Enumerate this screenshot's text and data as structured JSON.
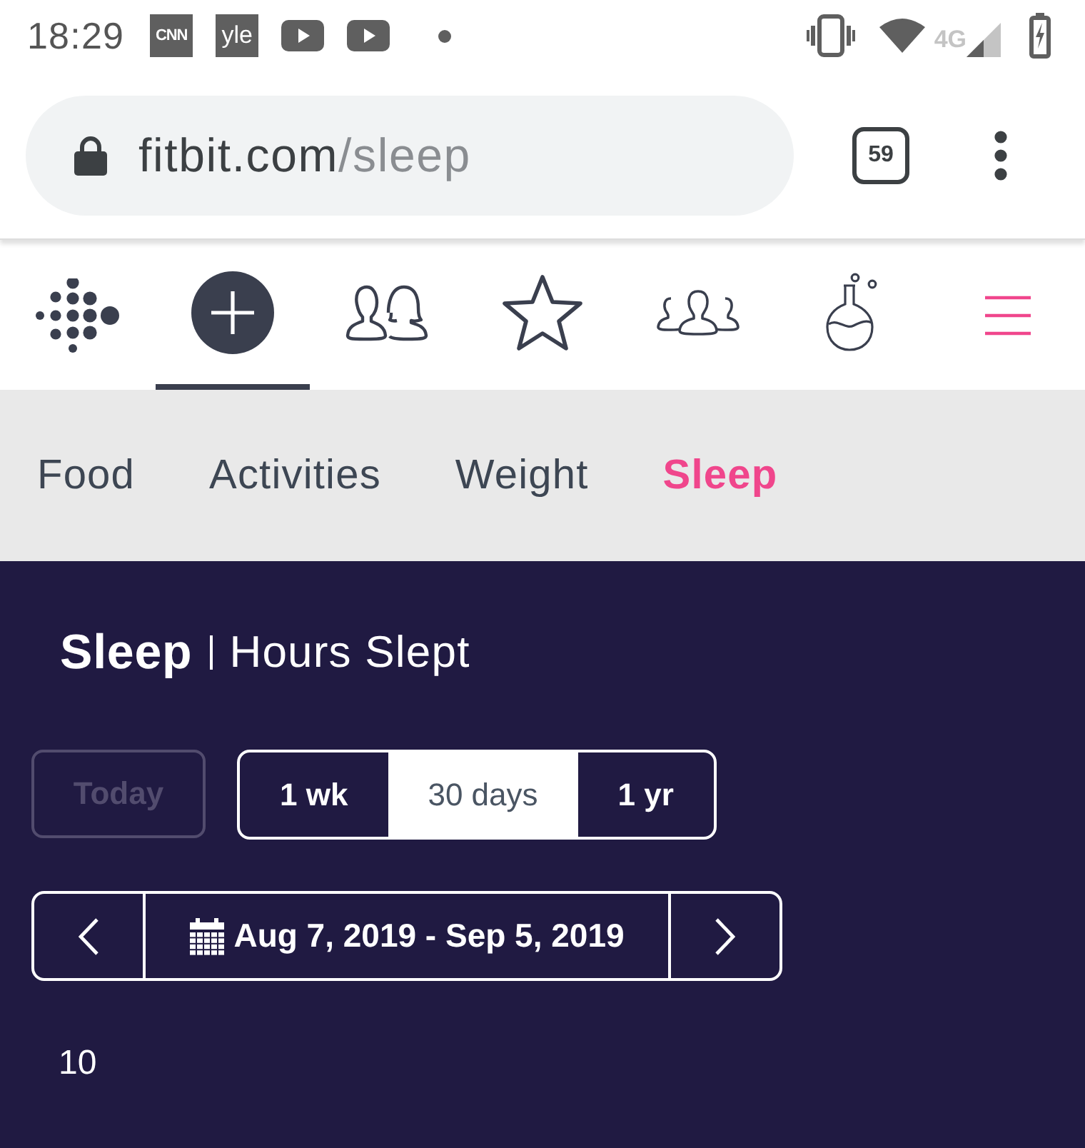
{
  "status_bar": {
    "time": "18:29",
    "notifications": [
      {
        "kind": "logo",
        "text": "CNN"
      },
      {
        "kind": "logo",
        "text": "yle"
      },
      {
        "kind": "video"
      },
      {
        "kind": "video"
      },
      {
        "kind": "dot"
      }
    ],
    "network": "4G"
  },
  "browser": {
    "url_host": "fitbit.com",
    "url_path": "/sleep",
    "tab_count": "59"
  },
  "nav": {
    "items": [
      {
        "kind": "add",
        "selected": true
      },
      {
        "kind": "friends",
        "selected": false
      },
      {
        "kind": "star",
        "selected": false
      },
      {
        "kind": "community",
        "selected": false
      },
      {
        "kind": "labs",
        "selected": false
      }
    ]
  },
  "subnav": {
    "tabs": [
      {
        "label": "Food",
        "selected": false
      },
      {
        "label": "Activities",
        "selected": false
      },
      {
        "label": "Weight",
        "selected": false
      },
      {
        "label": "Sleep",
        "selected": true
      }
    ]
  },
  "panel": {
    "title": "Sleep",
    "subtitle": "Hours Slept",
    "today": {
      "label": "Today",
      "disabled": true
    },
    "ranges": [
      {
        "label": "1 wk",
        "selected": false
      },
      {
        "label": "30 days",
        "selected": true
      },
      {
        "label": "1 yr",
        "selected": false
      }
    ],
    "date_range": "Aug 7, 2019 - Sep 5, 2019",
    "chart": {
      "tick_label": "10"
    }
  }
}
